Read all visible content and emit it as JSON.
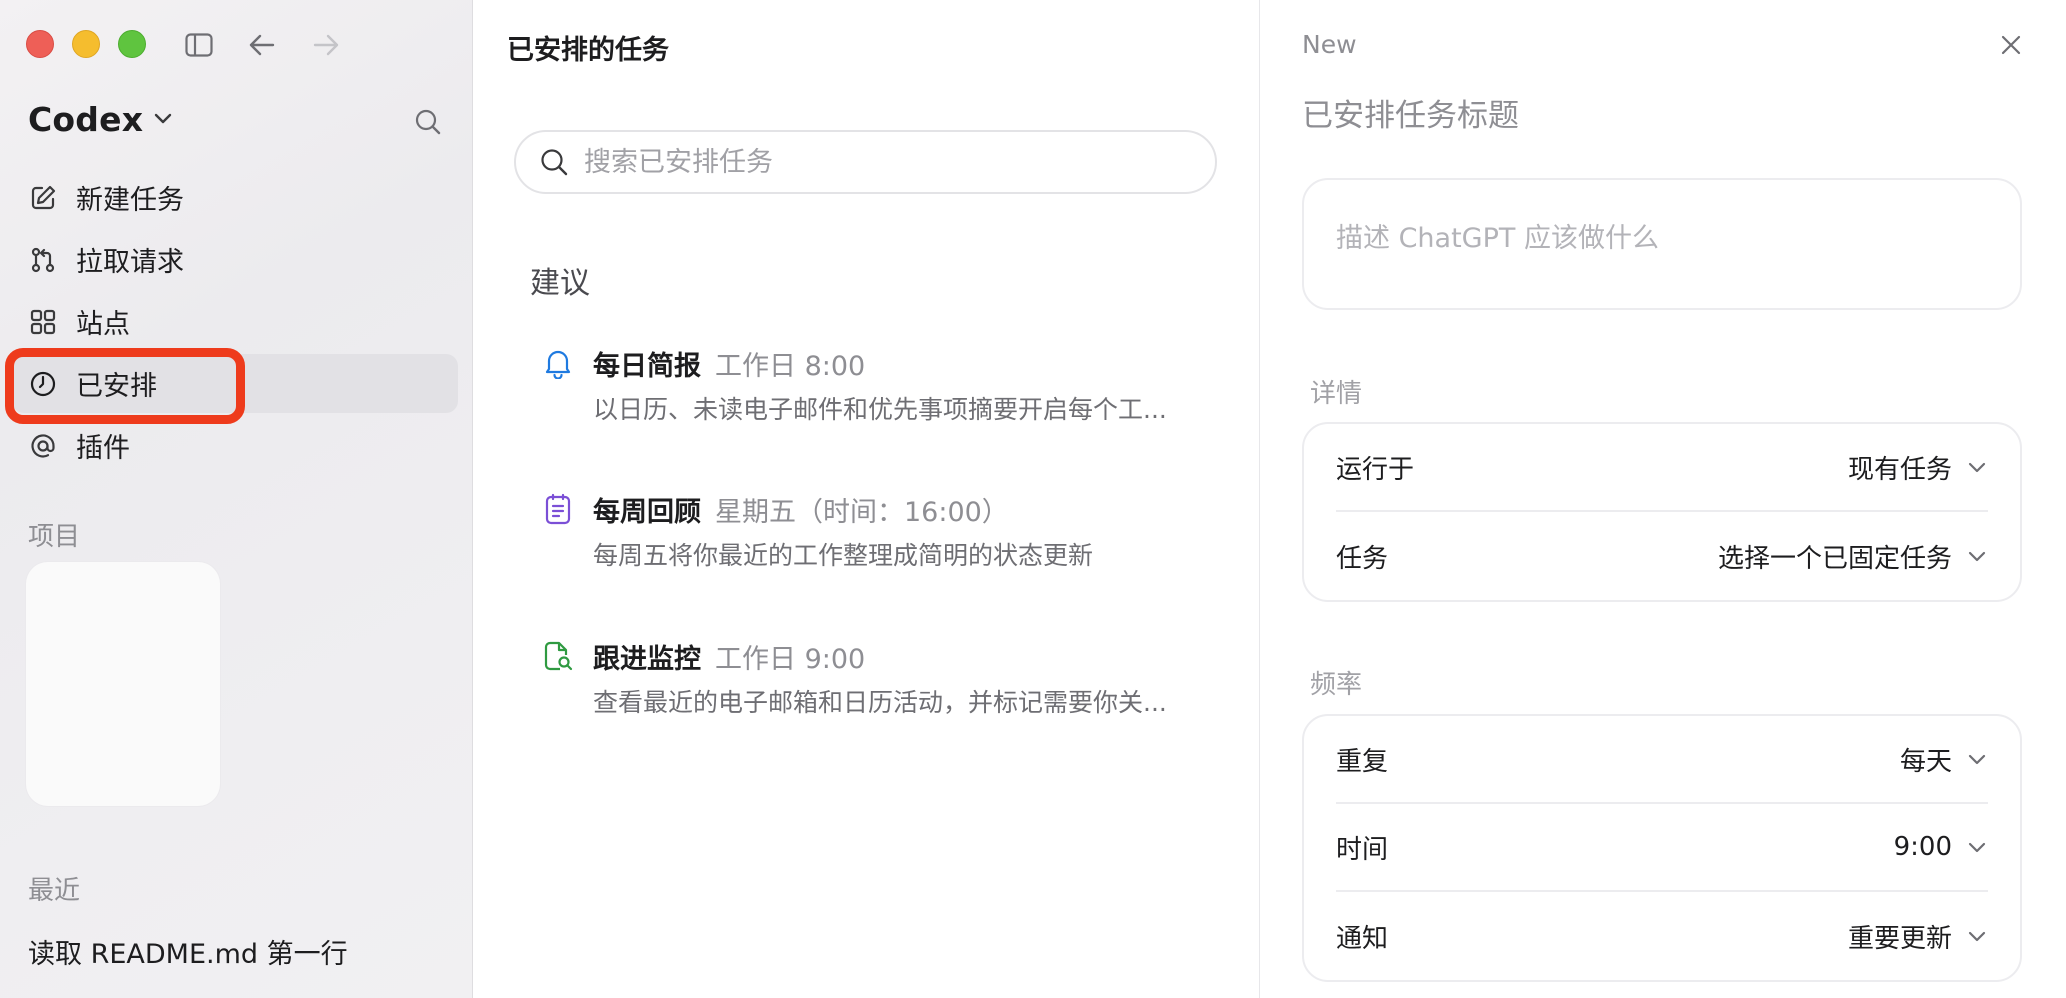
{
  "sidebar": {
    "brand": "Codex",
    "nav": [
      {
        "label": "新建任务",
        "icon": "compose-icon"
      },
      {
        "label": "拉取请求",
        "icon": "pull-request-icon"
      },
      {
        "label": "站点",
        "icon": "grid-icon"
      },
      {
        "label": "已安排",
        "icon": "clock-icon",
        "active": true
      },
      {
        "label": "插件",
        "icon": "at-sign-icon"
      }
    ],
    "projects_label": "项目",
    "recent_label": "最近",
    "recent_items": [
      "读取 README.md 第一行"
    ]
  },
  "middle": {
    "title": "已安排的任务",
    "search_placeholder": "搜索已安排任务",
    "suggestions_label": "建议",
    "suggestions": [
      {
        "name": "每日简报",
        "when": "工作日 8:00",
        "desc": "以日历、未读电子邮件和优先事项摘要开启每个工...",
        "icon": "bell-icon",
        "color": "#1f7ae0"
      },
      {
        "name": "每周回顾",
        "when": "星期五（时间：16:00）",
        "desc": "每周五将你最近的工作整理成简明的状态更新",
        "icon": "notepad-icon",
        "color": "#7b4fd6"
      },
      {
        "name": "跟进监控",
        "when": "工作日 9:00",
        "desc": "查看最近的电子邮箱和日历活动，并标记需要你关...",
        "icon": "document-search-icon",
        "color": "#2f9a41"
      }
    ]
  },
  "right": {
    "new_label": "New",
    "title_placeholder": "已安排任务标题",
    "desc_placeholder": "描述 ChatGPT 应该做什么",
    "details_label": "详情",
    "details": [
      {
        "key": "运行于",
        "value": "现有任务"
      },
      {
        "key": "任务",
        "value": "选择一个已固定任务"
      }
    ],
    "frequency_label": "频率",
    "frequency": [
      {
        "key": "重复",
        "value": "每天"
      },
      {
        "key": "时间",
        "value": "9:00"
      },
      {
        "key": "通知",
        "value": "重要更新"
      }
    ]
  },
  "colors": {
    "highlight": "#ee3b1c",
    "traffic_red": "#ee5f57",
    "traffic_yellow": "#f5bd2e",
    "traffic_green": "#5fc43f"
  }
}
